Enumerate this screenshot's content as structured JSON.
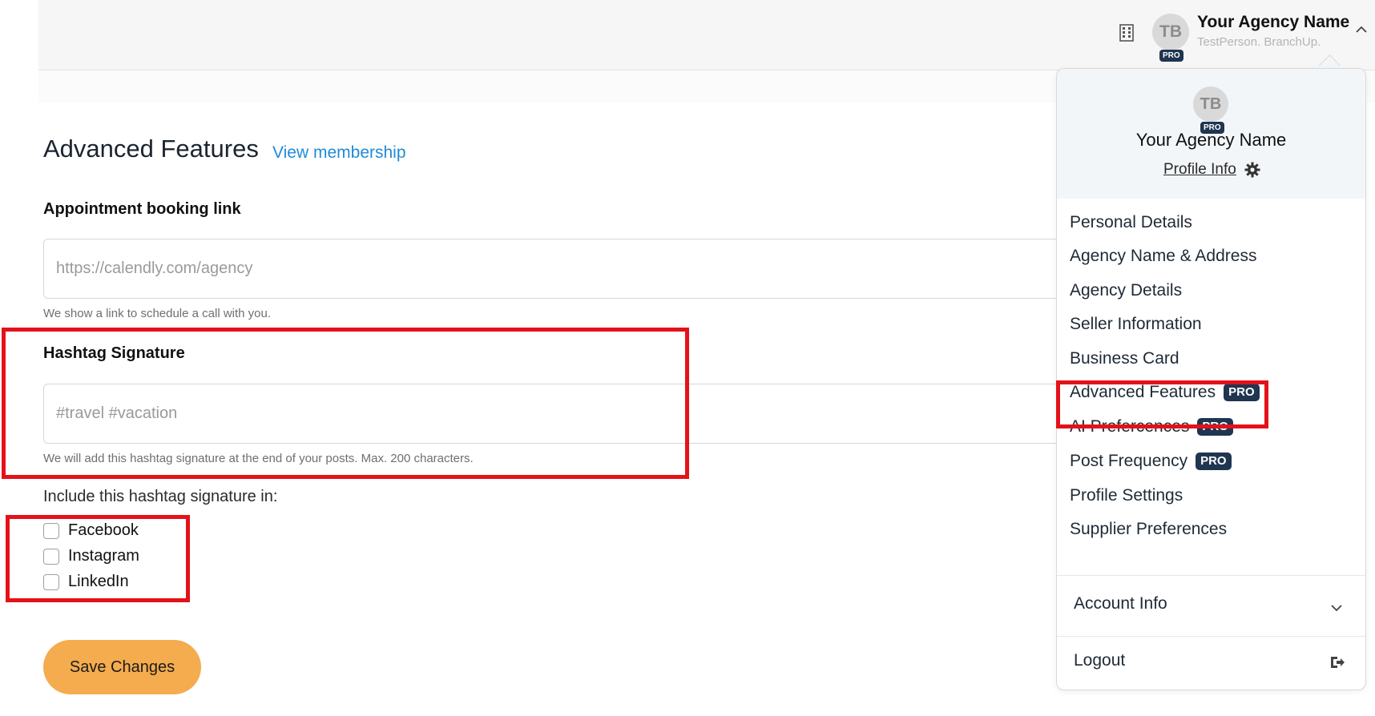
{
  "header": {
    "avatar_initials": "TB",
    "pro_label": "PRO",
    "agency_name": "Your Agency Name",
    "subtitle": "TestPerson. BranchUp.",
    "icons": [
      "building-icon",
      "chevron-up-icon"
    ]
  },
  "dropdown": {
    "avatar_initials": "TB",
    "pro_label": "PRO",
    "agency_name": "Your Agency Name",
    "profile_link": "Profile Info",
    "items": [
      {
        "label": "Personal Details",
        "pro": false
      },
      {
        "label": "Agency Name & Address",
        "pro": false
      },
      {
        "label": "Agency Details",
        "pro": false
      },
      {
        "label": "Seller Information",
        "pro": false
      },
      {
        "label": "Business Card",
        "pro": false
      },
      {
        "label": "Advanced Features",
        "pro": true,
        "badge": "PRO"
      },
      {
        "label": "AI Prefercences",
        "pro": true,
        "badge": "PRO"
      },
      {
        "label": "Post Frequency",
        "pro": true,
        "badge": "PRO"
      },
      {
        "label": "Profile Settings",
        "pro": false
      },
      {
        "label": "Supplier Preferences",
        "pro": false
      }
    ],
    "account_info": "Account Info",
    "logout": "Logout"
  },
  "main": {
    "title": "Advanced Features",
    "view_membership": "View membership",
    "booking": {
      "label": "Appointment booking link",
      "placeholder": "https://calendly.com/agency",
      "help": "We show a link to schedule a call with you."
    },
    "hashtag": {
      "label": "Hashtag Signature",
      "placeholder": "#travel #vacation",
      "help": "We will add this hashtag signature at the end of your posts. Max. 200 characters."
    },
    "include_label": "Include this hashtag signature in:",
    "platforms": [
      {
        "label": "Facebook",
        "checked": false
      },
      {
        "label": "Instagram",
        "checked": false
      },
      {
        "label": "LinkedIn",
        "checked": false
      }
    ],
    "save_label": "Save Changes"
  },
  "colors": {
    "accent_button": "#f4ac4e",
    "link": "#1f8bd6",
    "pro_badge": "#1f3550",
    "highlight": "#e3121a"
  }
}
